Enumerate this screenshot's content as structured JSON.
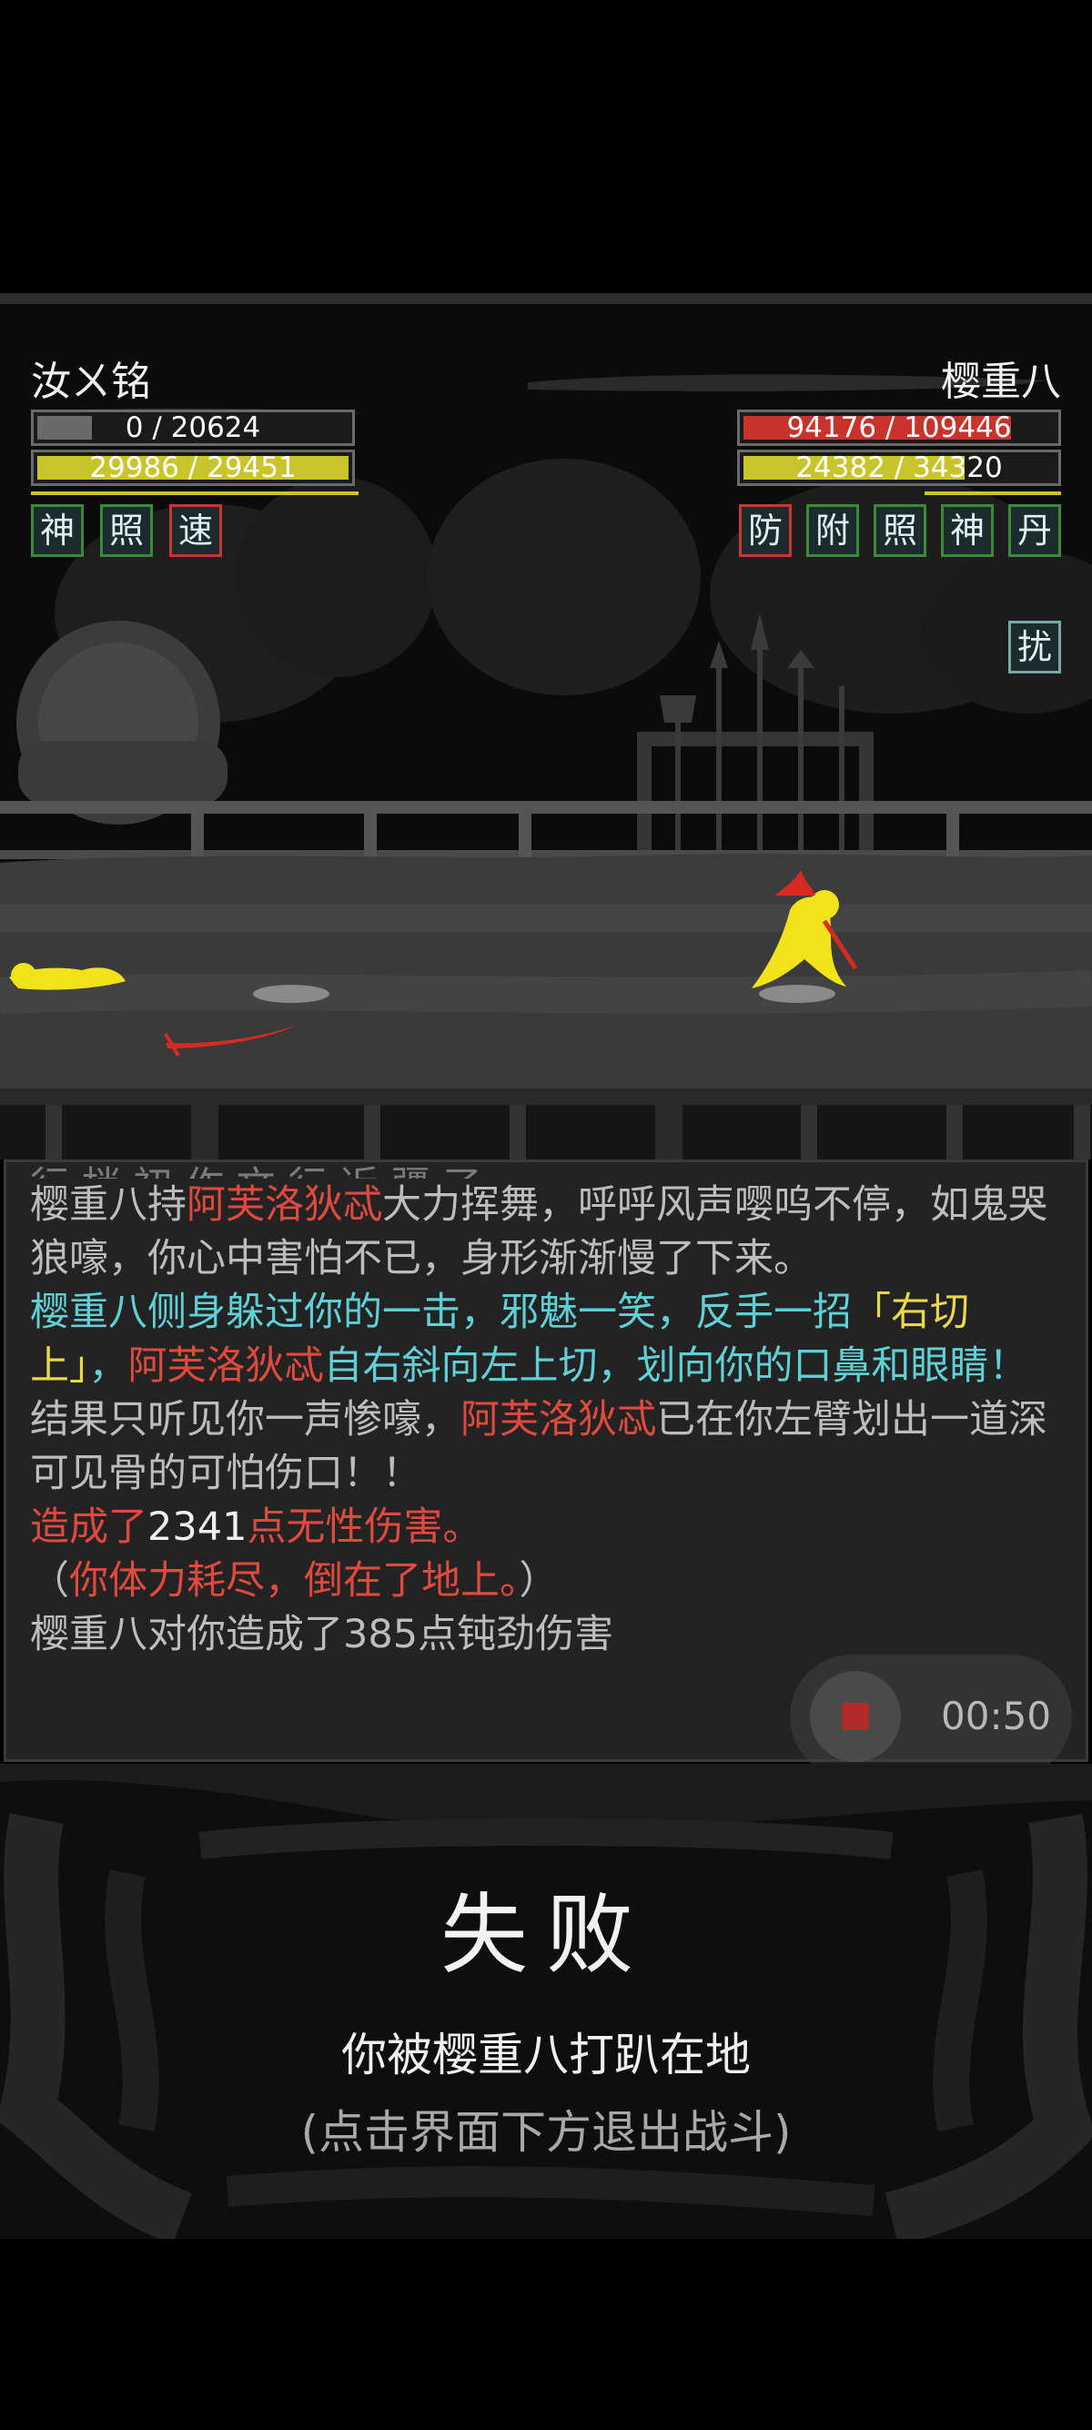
{
  "player": {
    "name": "汝ㄨ铭",
    "hp_text": "0 / 20624",
    "hp_fraction": 0.0,
    "mp_text": "29986 / 29451",
    "mp_fraction": 1.0,
    "statuses": [
      "神",
      "照",
      "速"
    ]
  },
  "enemy": {
    "name": "樱重八",
    "hp_text": "94176 / 109446",
    "hp_fraction": 0.86,
    "mp_text": "24382 / 34320",
    "mp_fraction": 0.71,
    "statuses": [
      "防",
      "附",
      "照",
      "神",
      "丹"
    ],
    "status_extra": "扰"
  },
  "log": {
    "cut_line": "行 梢 初 作 文 行 近 疆 了",
    "l1_a": "樱重八持",
    "l1_weapon": "阿芙洛狄忒",
    "l1_b": "大力挥舞，呼呼风声嘤呜不停，如鬼哭狼嚎，你心中害怕不已，身形渐渐慢了下来。",
    "l2_a": "樱重八侧身躲过你的一击，邪魅一笑，反手一招",
    "l2_move": "「右切上」",
    "l2_comma": "，",
    "l2_weapon": "阿芙洛狄忒",
    "l2_b": "自右斜向左上切，划向你的口鼻和眼睛！",
    "l3_a": "结果只听见你一声惨嚎，",
    "l3_weapon": "阿芙洛狄忒",
    "l3_b": "已在你左臂划出一道深可见骨的可怕伤口！！",
    "l4_a": "造成了",
    "l4_num": "2341",
    "l4_b": "点无性伤害。",
    "l5_open": "（",
    "l5_text": "你体力耗尽，倒在了地上。",
    "l5_close": "）",
    "l6": "樱重八对你造成了385点钝劲伤害"
  },
  "recorder": {
    "time": "00:50"
  },
  "result": {
    "title": "失败",
    "message": "你被樱重八打趴在地",
    "hint": "(点击界面下方退出战斗)"
  },
  "colors": {
    "hp_player": "#6a6a6a",
    "hp_enemy": "#c8342c",
    "mp_bar": "#c9c42b",
    "figure": "#f2e21a",
    "blade": "#d62a22",
    "log_red": "#e04a3e",
    "log_cyan": "#5fd0d6"
  },
  "icons": {
    "status_tile": "status-glyph-tile",
    "recorder": "record-stop-icon"
  }
}
